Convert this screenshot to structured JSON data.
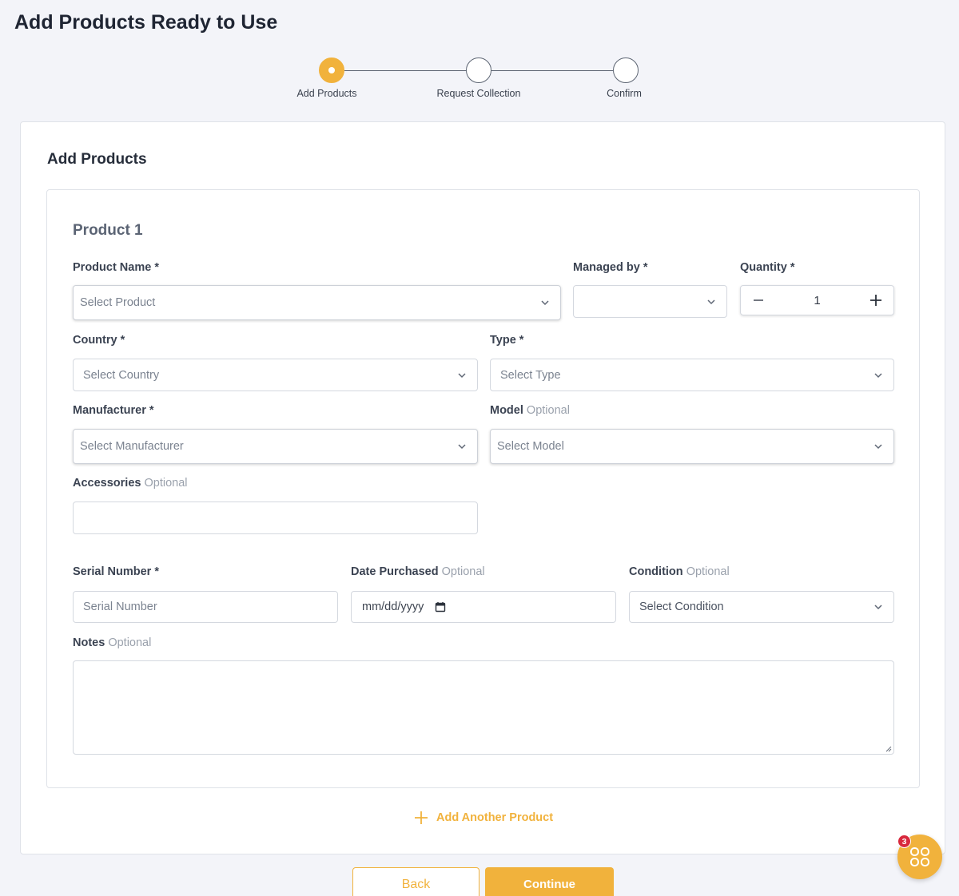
{
  "page": {
    "title": "Add Products Ready to Use"
  },
  "stepper": {
    "steps": [
      {
        "label": "Add Products",
        "state": "active"
      },
      {
        "label": "Request Collection",
        "state": "pending"
      },
      {
        "label": "Confirm",
        "state": "pending"
      }
    ]
  },
  "card": {
    "title": "Add Products"
  },
  "product": {
    "title": "Product 1",
    "product_name": {
      "label": "Product Name *",
      "placeholder": "Select Product"
    },
    "managed_by": {
      "label": "Managed by *",
      "value": ""
    },
    "quantity": {
      "label": "Quantity *",
      "value": "1"
    },
    "country": {
      "label": "Country *",
      "placeholder": "Select Country"
    },
    "type": {
      "label": "Type *",
      "placeholder": "Select Type"
    },
    "manufacturer": {
      "label": "Manufacturer *",
      "placeholder": "Select Manufacturer"
    },
    "model": {
      "label": "Model",
      "optional": "Optional",
      "placeholder": "Select Model"
    },
    "accessories": {
      "label": "Accessories",
      "optional": "Optional",
      "value": ""
    },
    "serial_number": {
      "label": "Serial Number *",
      "placeholder": "Serial Number"
    },
    "date_purchased": {
      "label": "Date Purchased",
      "optional": "Optional",
      "placeholder": "mm/dd/yyyy"
    },
    "condition": {
      "label": "Condition",
      "optional": "Optional",
      "value": "Select Condition"
    },
    "notes": {
      "label": "Notes",
      "optional": "Optional",
      "value": ""
    }
  },
  "actions": {
    "add_another": "Add Another Product",
    "back": "Back",
    "continue": "Continue"
  },
  "fab": {
    "badge_count": "3"
  },
  "colors": {
    "accent": "#f1b23c",
    "badge": "#d8283d",
    "background": "#f3f4f9"
  }
}
